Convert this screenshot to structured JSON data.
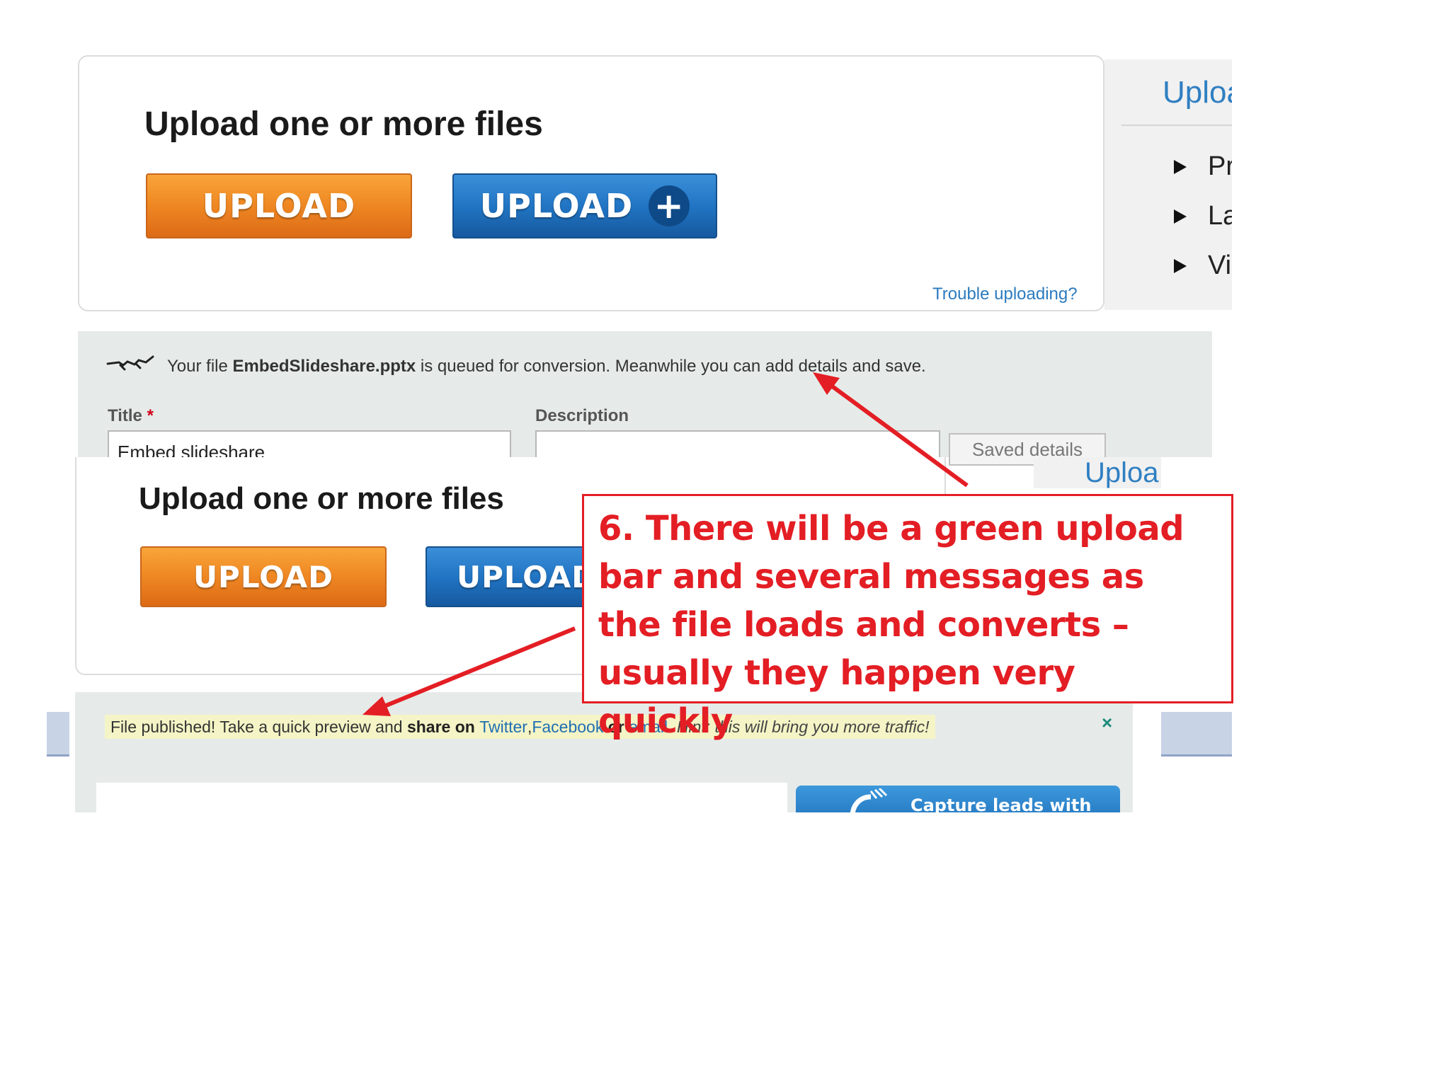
{
  "top_panel": {
    "heading": "Upload one or more files",
    "upload_label": "UPLOAD",
    "upload_plus_label": "UPLOAD",
    "plus_glyph": "+",
    "trouble_link": "Trouble uploading?"
  },
  "side_menu": {
    "title": "Uploa",
    "items": [
      "Pr",
      "La",
      "Vi"
    ]
  },
  "details": {
    "queue_prefix": "Your file ",
    "file_name": "EmbedSlideshare.pptx",
    "queue_suffix": " is queued for conversion. Meanwhile you can add details and save.",
    "title_label": "Title",
    "required_mark": "*",
    "title_value": "Embed slideshare",
    "description_label": "Description",
    "saved_button": "Saved details",
    "side_title": "Uploa"
  },
  "mid_panel": {
    "heading": "Upload one or more files",
    "upload_label": "UPLOAD",
    "upload_plus_label": "UPLOAD"
  },
  "published": {
    "msg_prefix": "File published! Take a quick preview and ",
    "share_label": "share on",
    "twitter": "Twitter",
    "comma": ", ",
    "facebook": "Facebook",
    "or_label": "or",
    "email": "email.",
    "hint": "Hint: this will bring you more traffic!",
    "close": "×",
    "capture_label": "Capture leads with"
  },
  "callout": {
    "text": "6. There will be a green upload bar and several messages as the file loads and converts – usually they happen very quickly"
  },
  "colors": {
    "callout_red": "#e31e24",
    "orange_button": "#f08a24",
    "blue_button": "#2175c4",
    "link_blue": "#1f6fb2",
    "panel_gray": "#e6ebe9"
  }
}
